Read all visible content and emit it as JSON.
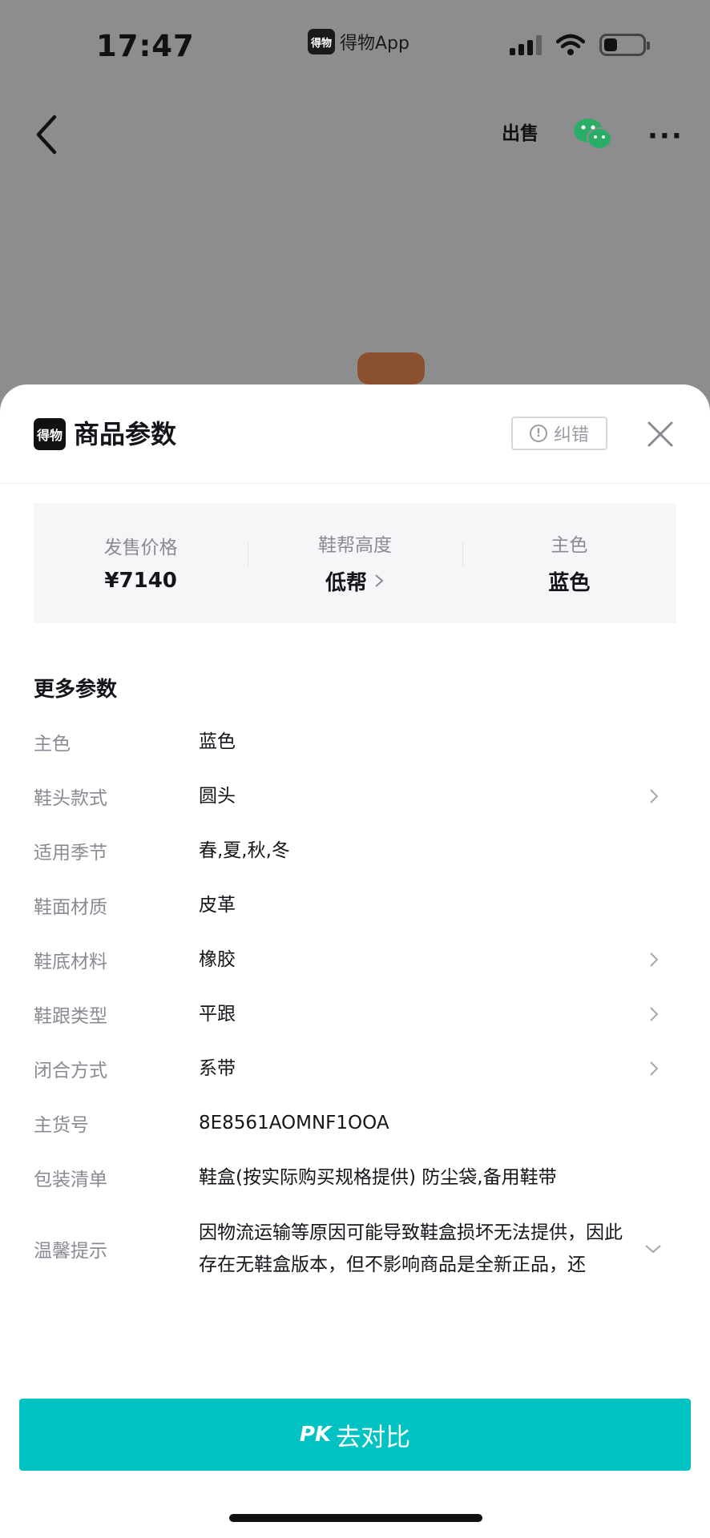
{
  "status_bar": {
    "time": "17:47",
    "app_name": "得物App",
    "app_logo_text": "得物",
    "battery_level": 0.35
  },
  "nav": {
    "sell_label": "出售"
  },
  "sheet": {
    "brand_logo_text": "得物",
    "title": "商品参数",
    "report_label": "纠错",
    "summary": [
      {
        "label": "发售价格",
        "value": "¥7140",
        "has_chevron": false
      },
      {
        "label": "鞋帮高度",
        "value": "低帮",
        "has_chevron": true
      },
      {
        "label": "主色",
        "value": "蓝色",
        "has_chevron": false
      }
    ],
    "more_title": "更多参数",
    "params": [
      {
        "label": "主色",
        "value": "蓝色",
        "chevron": false
      },
      {
        "label": "鞋头款式",
        "value": "圆头",
        "chevron": true
      },
      {
        "label": "适用季节",
        "value": "春,夏,秋,冬",
        "chevron": false
      },
      {
        "label": "鞋面材质",
        "value": "皮革",
        "chevron": false
      },
      {
        "label": "鞋底材料",
        "value": "橡胶",
        "chevron": true
      },
      {
        "label": "鞋跟类型",
        "value": "平跟",
        "chevron": true
      },
      {
        "label": "闭合方式",
        "value": "系带",
        "chevron": true
      },
      {
        "label": "主货号",
        "value": "8E8561AOMNF1OOA",
        "chevron": false
      },
      {
        "label": "包装清单",
        "value": "鞋盒(按实际购买规格提供) 防尘袋,备用鞋带",
        "chevron": false
      },
      {
        "label": "温馨提示",
        "value": "因物流运输等原因可能导致鞋盒损坏无法提供，因此存在无鞋盒版本，但不影响商品是全新正品，还",
        "expand": true
      }
    ]
  },
  "footer": {
    "pk_badge": "PK",
    "pk_text": "去对比"
  },
  "colors": {
    "accent": "#01c2c3",
    "wechat_green": "#2aae67",
    "dimmed_background": "#8d8d8f"
  }
}
